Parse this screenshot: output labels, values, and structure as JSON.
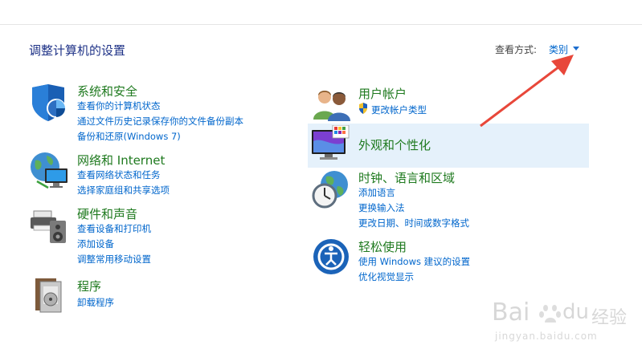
{
  "header": {
    "title": "调整计算机的设置",
    "view_by_label": "查看方式:",
    "view_by_value": "类别"
  },
  "categories_left": [
    {
      "title": "系统和安全",
      "icon": "shield-icon",
      "links": [
        "查看你的计算机状态",
        "通过文件历史记录保存你的文件备份副本",
        "备份和还原(Windows 7)"
      ]
    },
    {
      "title": "网络和 Internet",
      "icon": "network-globe-icon",
      "links": [
        "查看网络状态和任务",
        "选择家庭组和共享选项"
      ]
    },
    {
      "title": "硬件和声音",
      "icon": "printer-speaker-icon",
      "links": [
        "查看设备和打印机",
        "添加设备",
        "调整常用移动设置"
      ]
    },
    {
      "title": "程序",
      "icon": "programs-icon",
      "links": [
        "卸载程序"
      ]
    }
  ],
  "categories_right": [
    {
      "title": "用户帐户",
      "icon": "users-icon",
      "links": [
        "更改帐户类型"
      ]
    },
    {
      "title": "外观和个性化",
      "icon": "monitor-palette-icon",
      "links": []
    },
    {
      "title": "时钟、语言和区域",
      "icon": "clock-globe-icon",
      "links": [
        "添加语言",
        "更换输入法",
        "更改日期、时间或数字格式"
      ]
    },
    {
      "title": "轻松使用",
      "icon": "ease-of-access-icon",
      "links": [
        "使用 Windows 建议的设置",
        "优化视觉显示"
      ]
    }
  ],
  "watermark": {
    "brand": "Bai",
    "brand2": "du",
    "suffix": "经验",
    "url": "jingyan.baidu.com"
  },
  "colors": {
    "title_green": "#1f7a1f",
    "link_blue": "#0066cc",
    "highlight": "#e5f1fb",
    "annotation_arrow": "#e8473a"
  }
}
